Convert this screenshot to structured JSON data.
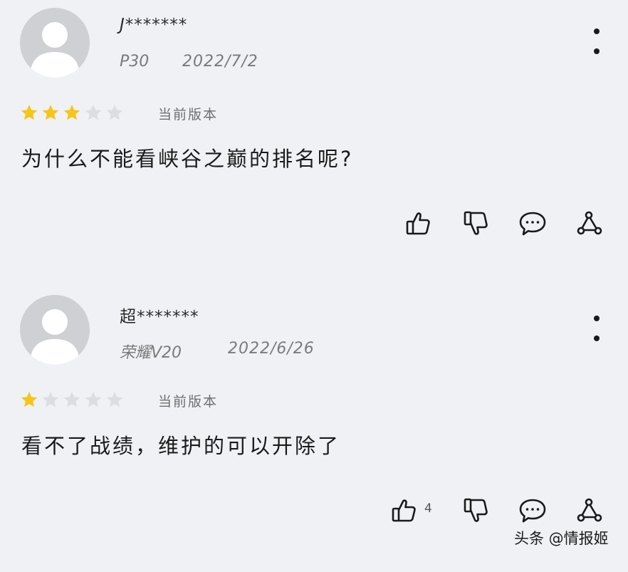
{
  "reviews": [
    {
      "username": "J*******",
      "device": "P30",
      "date": "2022/7/2",
      "rating": 3,
      "max_rating": 5,
      "version_label": "当前版本",
      "comment": "为什么不能看峡谷之巅的排名呢?",
      "like_count": ""
    },
    {
      "username": "超*******",
      "device": "荣耀V20",
      "date": "2022/6/26",
      "rating": 1,
      "max_rating": 5,
      "version_label": "当前版本",
      "comment": "看不了战绩，维护的可以开除了",
      "like_count": "4"
    }
  ],
  "icons": {
    "more": "more-vertical-icon",
    "like": "thumbs-up-icon",
    "dislike": "thumbs-down-icon",
    "reply": "comment-bubble-icon",
    "share": "share-icon",
    "avatar": "user-avatar-icon"
  },
  "colors": {
    "star_filled": "#f5c518",
    "star_empty": "#dcdde0",
    "background": "#f0f1f5"
  },
  "watermark": "头条 @情报姬"
}
